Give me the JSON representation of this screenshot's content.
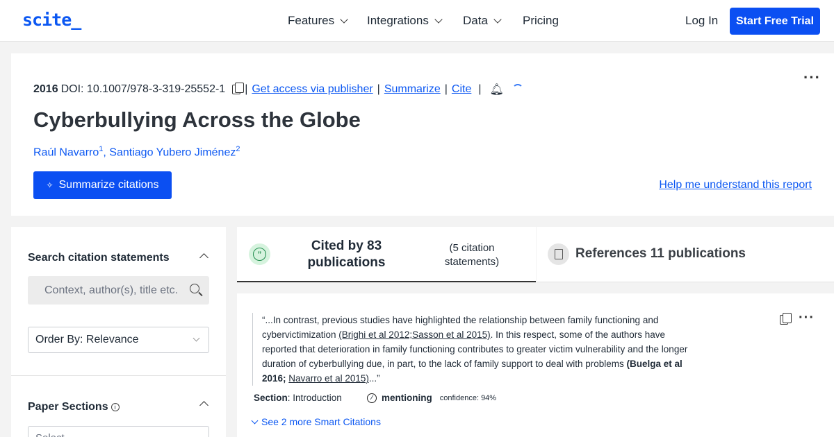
{
  "header": {
    "logo": "scite_",
    "nav": [
      {
        "label": "Features",
        "dropdown": true
      },
      {
        "label": "Integrations",
        "dropdown": true
      },
      {
        "label": "Data",
        "dropdown": true
      },
      {
        "label": "Pricing",
        "dropdown": false
      }
    ],
    "login": "Log In",
    "trial": "Start Free Trial"
  },
  "paper": {
    "year": "2016",
    "doi": "DOI: 10.1007/978-3-319-25552-1",
    "links": [
      "Get access via publisher",
      "Summarize",
      "Cite"
    ],
    "separator": "|",
    "title": "Cyberbullying Across the Globe",
    "authors": [
      {
        "name": "Raúl Navarro",
        "sup": "1"
      },
      {
        "name": "Santiago Yubero Jiménez",
        "sup": "2"
      }
    ],
    "author_sep": ",",
    "summarize_btn": "Summarize citations",
    "help_link": "Help me understand this report"
  },
  "sidebar": {
    "search_heading": "Search citation statements",
    "search_placeholder": "Context, author(s), title etc.",
    "order_by": "Order By: Relevance",
    "sections_heading": "Paper Sections",
    "info_glyph": "i",
    "select_placeholder": "Select..."
  },
  "tabs": {
    "cited_by": "Cited by 83 publications",
    "citation_statements": "(5 citation statements)",
    "references": "References 11 publications"
  },
  "citation": {
    "q_open": "“...In contrast, previous studies have highlighted the relationship between family functioning and cybervictimization ",
    "ref1": "(Brighi et al 2012;Sasson et al 2015)",
    "q_mid": ". In this respect, some of the authors have reported that deterioration in family functioning contributes to greater victim vulnerability and the longer duration of cyberbullying due, in part, to the lack of family support to deal with problems ",
    "ref2": "(Buelga et al 2016;",
    "ref3": "Navarro et al 2015)",
    "q_close": "...”",
    "section_label": "Section",
    "section_value": ": Introduction",
    "mention": "mentioning",
    "confidence": "confidence: 94%",
    "more": "See 2 more Smart Citations"
  },
  "colors": {
    "accent": "#0b4ff2",
    "link": "#0b57f2",
    "supporting_bg": "#d6f3de"
  }
}
